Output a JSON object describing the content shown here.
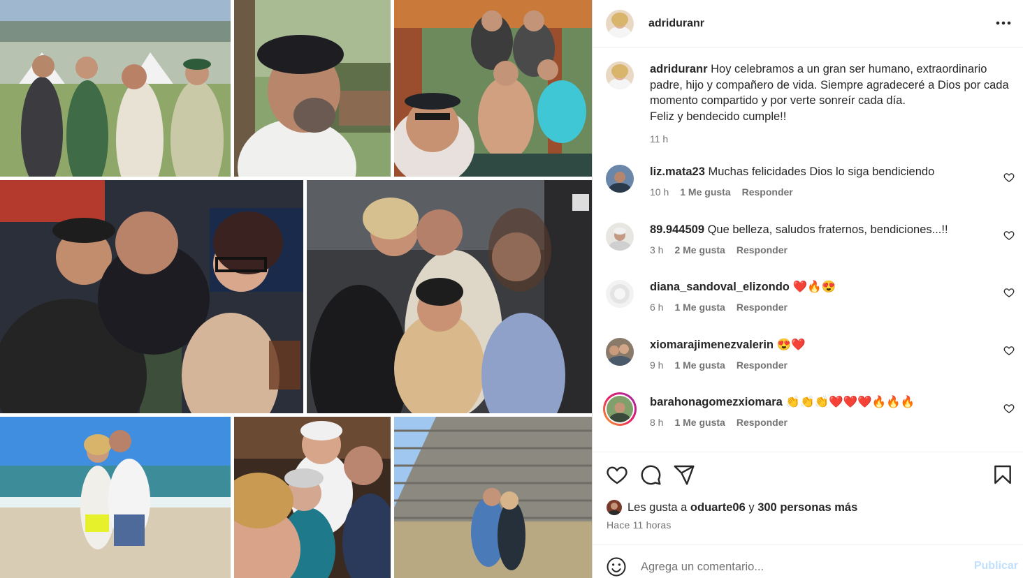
{
  "post": {
    "username": "adriduranr",
    "more_icon": "more-horizontal-icon",
    "caption": {
      "username": "adriduranr",
      "text": "Hoy celebramos a un gran ser humano, extraordinario padre, hijo y compañero de vida. Siempre agradeceré a Dios por cada momento compartido y por verte sonreír cada día.\nFeliz y bendecido cumple!!",
      "time": "11 h"
    },
    "comments": [
      {
        "username": "liz.mata23",
        "text": "Muchas felicidades Dios lo siga bendiciendo",
        "time": "10 h",
        "likes": "1 Me gusta",
        "reply": "Responder"
      },
      {
        "username": "89.944509",
        "text": "Que belleza, saludos fraternos, bendiciones...!!",
        "time": "3 h",
        "likes": "2 Me gusta",
        "reply": "Responder"
      },
      {
        "username": "diana_sandoval_elizondo",
        "text": "❤️🔥😍",
        "time": "6 h",
        "likes": "1 Me gusta",
        "reply": "Responder"
      },
      {
        "username": "xiomarajimenezvalerin",
        "text": "😍❤️",
        "time": "9 h",
        "likes": "1 Me gusta",
        "reply": "Responder"
      },
      {
        "username": "barahonagomezxiomara",
        "text": "👏👏👏❤️❤️❤️🔥🔥🔥",
        "time": "8 h",
        "likes": "1 Me gusta",
        "reply": "Responder"
      }
    ],
    "likes": {
      "prefix": "Les gusta a",
      "user": "oduarte06",
      "joiner": "y",
      "others": "300 personas más"
    },
    "time_ago": "Hace 11 horas",
    "add_comment": {
      "placeholder": "Agrega un comentario...",
      "publish": "Publicar"
    }
  },
  "colors": {
    "text": "#262626",
    "secondary": "#737373",
    "border": "#dbdbdb",
    "publish_disabled": "#c0dffd"
  },
  "icons": [
    "like-icon",
    "comment-icon",
    "share-icon",
    "save-icon",
    "emoji-icon",
    "heart-small-icon"
  ]
}
